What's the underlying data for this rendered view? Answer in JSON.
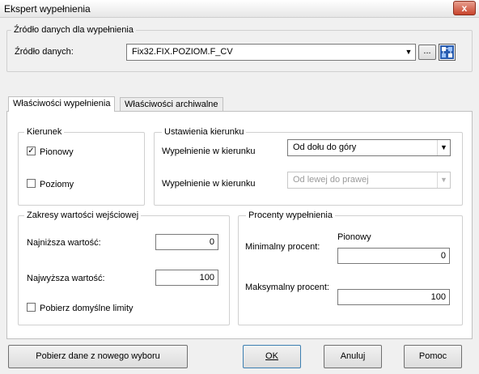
{
  "window": {
    "title": "Ekspert wypełnienia",
    "close_label": "x"
  },
  "source_group": {
    "label": "Źródło danych dla wypełnienia",
    "field_label": "Źródło danych:",
    "value": "Fix32.FIX.POZIOM.F_CV",
    "browse_label": "..."
  },
  "tabs": [
    {
      "label": "Właściwości wypełnienia",
      "active": true
    },
    {
      "label": "Właściwości archiwalne",
      "active": false
    }
  ],
  "direction_group": {
    "label": "Kierunek",
    "vertical_label": "Pionowy",
    "vertical_checked": true,
    "horizontal_label": "Poziomy",
    "horizontal_checked": false
  },
  "direction_settings": {
    "label": "Ustawienia kierunku",
    "row1_label": "Wypełnienie w kierunku",
    "row1_value": "Od dołu do góry",
    "row2_label": "Wypełnienie w kierunku",
    "row2_value": "Od lewej do prawej"
  },
  "input_range": {
    "label": "Zakresy wartości wejściowej",
    "min_label": "Najniższa wartość:",
    "min_value": "0",
    "max_label": "Najwyższa wartość:",
    "max_value": "100",
    "default_limits_label": "Pobierz domyślne limity",
    "default_limits_checked": false
  },
  "fill_percent": {
    "label": "Procenty wypełnienia",
    "column_label": "Pionowy",
    "min_label": "Minimalny procent:",
    "min_value": "0",
    "max_label": "Maksymalny procent:",
    "max_value": "100"
  },
  "buttons": {
    "fetch": "Pobierz dane z nowego wyboru",
    "ok": "OK",
    "cancel": "Anuluj",
    "help": "Pomoc"
  }
}
